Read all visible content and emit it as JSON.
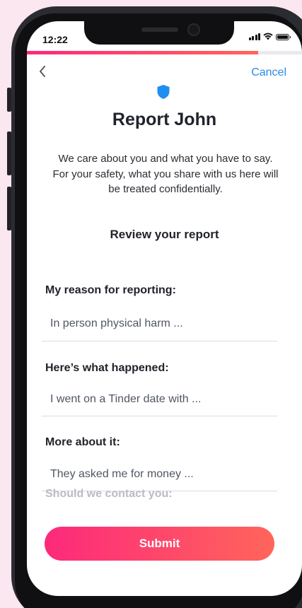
{
  "status_bar": {
    "time": "12:22"
  },
  "progress": {
    "fraction": 0.84
  },
  "nav": {
    "cancel_label": "Cancel"
  },
  "header": {
    "title": "Report John",
    "intro": "We care about you and what you have to say. For your safety, what you share with us here will be treated confidentially."
  },
  "review": {
    "heading": "Review your report",
    "sections": [
      {
        "label": "My reason for reporting:",
        "value": "In person physical harm ..."
      },
      {
        "label": "Here’s what happened:",
        "value": "I went on a Tinder date with ..."
      },
      {
        "label": "More about it:",
        "value": "They asked me for money ..."
      }
    ],
    "contact_label": "Should we contact you:"
  },
  "actions": {
    "submit_label": "Submit"
  },
  "colors": {
    "accent_start": "#fd297b",
    "accent_end": "#ff655b",
    "link": "#2a8ae8",
    "shield": "#1f8ef1"
  }
}
